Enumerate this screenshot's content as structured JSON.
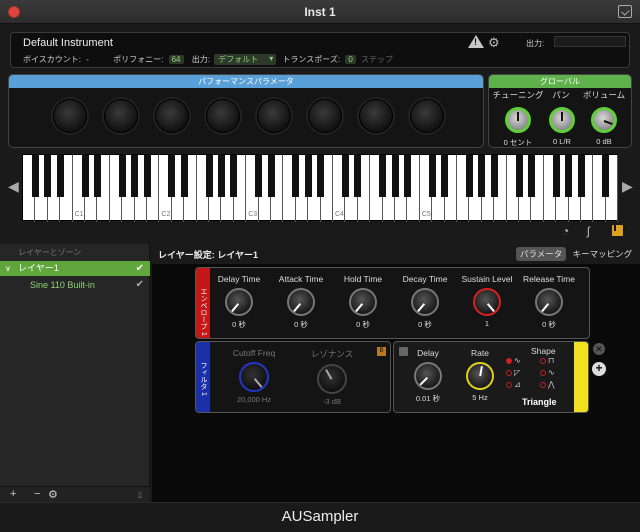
{
  "window": {
    "title": "Inst 1"
  },
  "instrument": {
    "name": "Default Instrument",
    "voice_count_label": "ボイスカウント:",
    "voice_count_value": "-",
    "polyphony_label": "ポリフォニー:",
    "polyphony_value": "64",
    "output_label": "出力:",
    "output_value": "デフォルト",
    "transpose_label": "トランスポーズ:",
    "transpose_value": "0",
    "step_label": "ステップ",
    "output2_label": "出力:"
  },
  "performance": {
    "title": "パフォーマンスパラメータ"
  },
  "global": {
    "title": "グローバル",
    "knobs": [
      {
        "label": "チューニング",
        "value": "0 セント"
      },
      {
        "label": "パン",
        "value": "0 L/R"
      },
      {
        "label": "ボリューム",
        "value": "0 dB"
      }
    ]
  },
  "keyboard": {
    "octave_labels": [
      "C1",
      "C2",
      "C3",
      "C4",
      "C5"
    ]
  },
  "sidebar": {
    "header": "レイヤーとゾーン",
    "layer": "レイヤー1",
    "zone": "Sine 110 Built-in",
    "check": "✔",
    "footer": {
      "add": "+",
      "remove": "−",
      "gear": "⚙︎",
      "grip": "⦙⦙"
    }
  },
  "layer_settings": {
    "title": "レイヤー設定: レイヤー1"
  },
  "tabs": {
    "params": "パラメータ",
    "keymap": "キーマッピング"
  },
  "envelope": {
    "tab": "エンベロープ 1",
    "params": [
      {
        "label": "Delay Time",
        "value": "0 秒"
      },
      {
        "label": "Attack Time",
        "value": "0 秒"
      },
      {
        "label": "Hold Time",
        "value": "0 秒"
      },
      {
        "label": "Decay Time",
        "value": "0 秒"
      },
      {
        "label": "Sustain Level",
        "value": "1"
      },
      {
        "label": "Release Time",
        "value": "0 秒"
      }
    ]
  },
  "filter": {
    "tab": "フィルタ 1",
    "badge": "B",
    "cutoff_label": "Cutoff Freq",
    "cutoff_value": "20,000 Hz",
    "resonance_label": "レゾナンス",
    "resonance_value": "-3 dB"
  },
  "lfo": {
    "delay_label": "Delay",
    "delay_value": "0.01 秒",
    "rate_label": "Rate",
    "rate_value": "5 Hz",
    "shape_label": "Shape",
    "shape_value": "Triangle",
    "shapes": [
      "∿",
      "⊓",
      "◸",
      "∿",
      "⊿",
      "⋀",
      "⊿",
      "⋀"
    ]
  },
  "app": {
    "name": "AUSampler"
  }
}
